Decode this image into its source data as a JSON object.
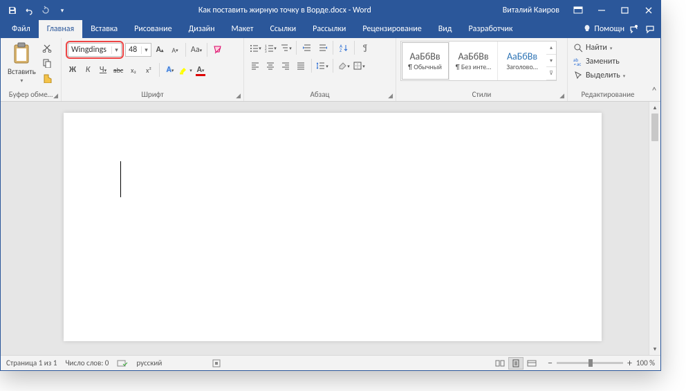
{
  "title": "Как поставить жирную точку в Ворде.docx  -  Word",
  "user": "Виталий Каиров",
  "tabs": {
    "file": "Файл",
    "home": "Главная",
    "insert": "Вставка",
    "draw": "Рисование",
    "design": "Дизайн",
    "layout": "Макет",
    "references": "Ссылки",
    "mailings": "Рассылки",
    "review": "Рецензирование",
    "view": "Вид",
    "developer": "Разработчик"
  },
  "help": "Помощн",
  "ribbon": {
    "clipboard": {
      "label": "Буфер обме…",
      "paste": "Вставить"
    },
    "font": {
      "label": "Шрифт",
      "name": "Wingdings",
      "size": "48",
      "grow": "A",
      "shrink": "A",
      "case": "Aa",
      "clear": "✓",
      "bold": "Ж",
      "italic": "К",
      "underline": "Ч",
      "strike": "abc",
      "sub": "x₂",
      "sup": "x²"
    },
    "paragraph": {
      "label": "Абзац"
    },
    "styles": {
      "label": "Стили",
      "items": [
        {
          "preview": "АаБбВв",
          "name": "¶ Обычный"
        },
        {
          "preview": "АаБбВв",
          "name": "¶ Без инте…"
        },
        {
          "preview": "АаБбВв",
          "name": "Заголово…"
        }
      ]
    },
    "editing": {
      "label": "Редактирование",
      "find": "Найти",
      "replace": "Заменить",
      "select": "Выделить"
    }
  },
  "status": {
    "page": "Страница 1 из 1",
    "words": "Число слов: 0",
    "lang": "русский",
    "zoom": "100 %"
  }
}
